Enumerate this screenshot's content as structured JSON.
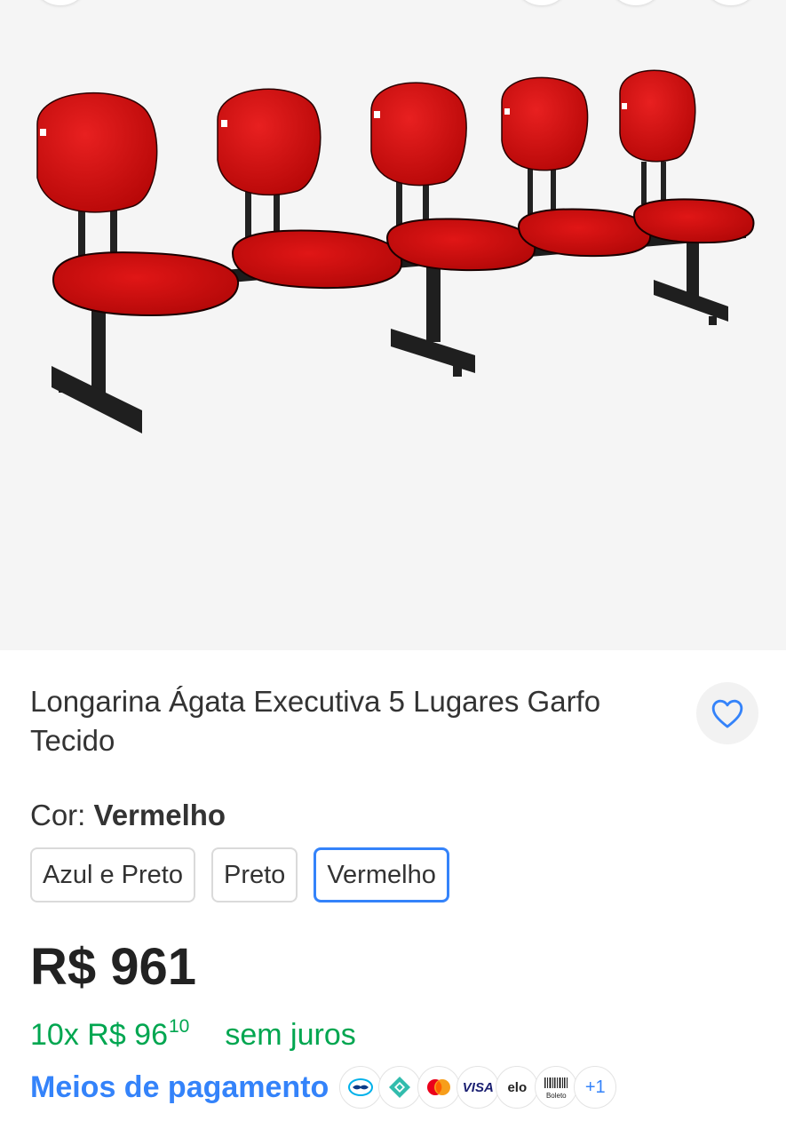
{
  "product": {
    "title": "Longarina Ágata Executiva 5 Lugares Garfo Tecido",
    "image_description_icon": "product-photo-red-5-seat-bench"
  },
  "color": {
    "label": "Cor:",
    "selected": "Vermelho",
    "options": [
      "Azul e Preto",
      "Preto",
      "Vermelho"
    ]
  },
  "price": {
    "value": "R$ 961",
    "installments": "10x R$ 96",
    "installments_cents": "10",
    "installments_note": "sem juros"
  },
  "payment": {
    "link_label": "Meios de pagamento",
    "methods": [
      {
        "icon": "mercado-pago-icon"
      },
      {
        "icon": "pix-icon"
      },
      {
        "icon": "mastercard-icon"
      },
      {
        "icon": "visa-icon",
        "label": "VISA"
      },
      {
        "icon": "elo-icon",
        "label": "elo"
      },
      {
        "icon": "boleto-icon",
        "label": "Boleto"
      }
    ],
    "more": "+1"
  },
  "colors": {
    "accent": "#3483fa",
    "green": "#00a650",
    "seat_red": "#d40e0e",
    "text": "#333333"
  }
}
